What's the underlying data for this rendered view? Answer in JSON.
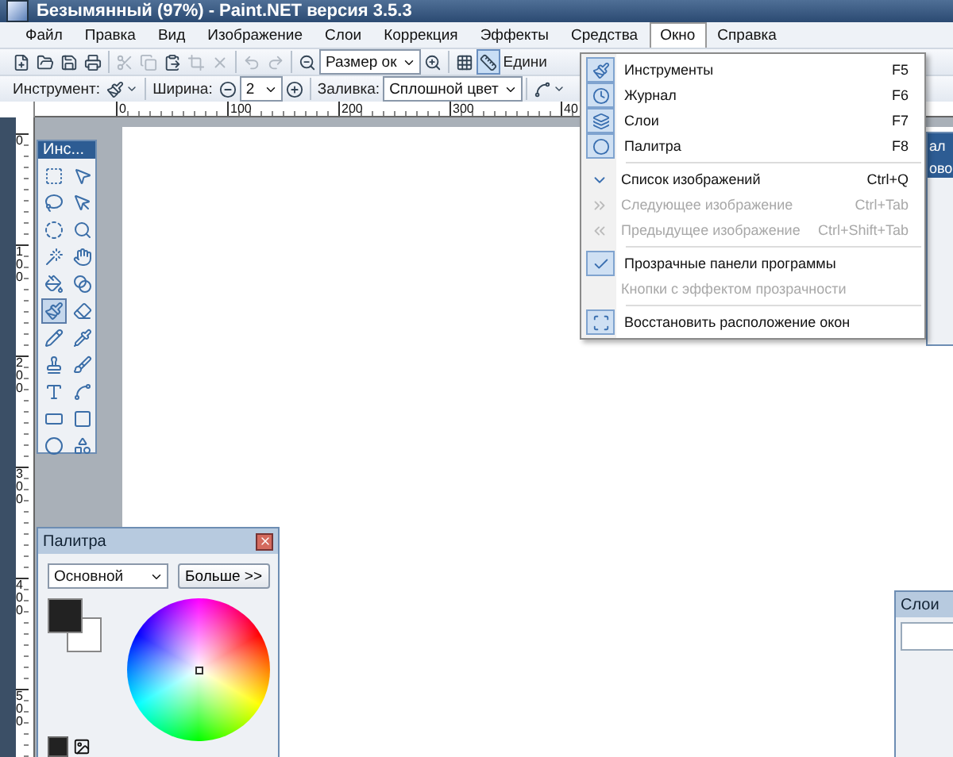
{
  "window": {
    "title": "Безымянный (97%) - Paint.NET версия 3.5.3"
  },
  "menu_bar": [
    {
      "label": "Файл",
      "selected": false
    },
    {
      "label": "Правка",
      "selected": false
    },
    {
      "label": "Вид",
      "selected": false
    },
    {
      "label": "Изображение",
      "selected": false
    },
    {
      "label": "Слои",
      "selected": false
    },
    {
      "label": "Коррекция",
      "selected": false
    },
    {
      "label": "Эффекты",
      "selected": false
    },
    {
      "label": "Средства",
      "selected": false
    },
    {
      "label": "Окно",
      "selected": true
    },
    {
      "label": "Справка",
      "selected": false
    }
  ],
  "toolbar_rows": [
    [
      {
        "kind": "button",
        "disabled": false
      },
      {
        "kind": "button",
        "disabled": false
      },
      {
        "kind": "button",
        "disabled": false
      },
      {
        "kind": "button",
        "disabled": false
      },
      {
        "kind": "separator"
      },
      {
        "kind": "button",
        "disabled": true
      },
      {
        "kind": "button",
        "disabled": true
      },
      {
        "kind": "button",
        "disabled": false
      },
      {
        "kind": "button",
        "disabled": true
      },
      {
        "kind": "button",
        "disabled": true
      },
      {
        "kind": "separator"
      },
      {
        "kind": "button",
        "disabled": true
      },
      {
        "kind": "button",
        "disabled": true
      },
      {
        "kind": "separator"
      },
      {
        "kind": "button",
        "disabled": false
      },
      {
        "kind": "select",
        "value": "Размер ок"
      },
      {
        "kind": "button",
        "disabled": false
      },
      {
        "kind": "separator"
      },
      {
        "kind": "button",
        "disabled": false,
        "on": false
      },
      {
        "kind": "button",
        "disabled": false,
        "on": true
      },
      {
        "kind": "label",
        "text": "Едини"
      }
    ],
    [
      {
        "kind": "label",
        "text": "Инструмент:"
      },
      {
        "kind": "button",
        "disabled": false
      },
      {
        "kind": "separator"
      },
      {
        "kind": "label",
        "text": "Ширина:"
      },
      {
        "kind": "button",
        "disabled": false
      },
      {
        "kind": "select",
        "value": "2"
      },
      {
        "kind": "button",
        "disabled": false
      },
      {
        "kind": "separator"
      },
      {
        "kind": "label",
        "text": "Заливка:"
      },
      {
        "kind": "select",
        "value": "Сплошной цвет"
      },
      {
        "kind": "separator"
      },
      {
        "kind": "button",
        "disabled": false
      }
    ]
  ],
  "ruler": {
    "h_labels": [
      "0",
      "100",
      "200",
      "300",
      "40"
    ],
    "v_labels": [
      "0",
      "100",
      "200",
      "300",
      "400",
      "500"
    ]
  },
  "tools_window": {
    "title": "Инс...",
    "tools": [
      {
        "selected": false
      },
      {
        "selected": false
      },
      {
        "selected": false
      },
      {
        "selected": false
      },
      {
        "selected": false
      },
      {
        "selected": false
      },
      {
        "selected": false
      },
      {
        "selected": false
      },
      {
        "selected": false
      },
      {
        "selected": false
      },
      {
        "selected": true
      },
      {
        "selected": false
      },
      {
        "selected": false
      },
      {
        "selected": false
      },
      {
        "selected": false
      },
      {
        "selected": false
      },
      {
        "selected": false
      },
      {
        "selected": false
      },
      {
        "selected": false
      },
      {
        "selected": false
      },
      {
        "selected": false
      },
      {
        "selected": false
      }
    ]
  },
  "palette_window": {
    "title": "Палитра",
    "mode": "Основной",
    "more_button": "Больше >>"
  },
  "history_window": {
    "title": "ал",
    "item": "ово"
  },
  "layers_window": {
    "title": "Слои"
  },
  "window_menu": [
    {
      "kind": "item",
      "label": "Инструменты",
      "shortcut": "F5",
      "disabled": false,
      "checked": false
    },
    {
      "kind": "item",
      "label": "Журнал",
      "shortcut": "F6",
      "disabled": false,
      "checked": false
    },
    {
      "kind": "item",
      "label": "Слои",
      "shortcut": "F7",
      "disabled": false,
      "checked": false
    },
    {
      "kind": "item",
      "label": "Палитра",
      "shortcut": "F8",
      "disabled": false,
      "checked": false
    },
    {
      "kind": "separator"
    },
    {
      "kind": "item",
      "label": "Список изображений",
      "shortcut": "Ctrl+Q",
      "disabled": false,
      "checked": false
    },
    {
      "kind": "item",
      "label": "Следующее изображение",
      "shortcut": "Ctrl+Tab",
      "disabled": true,
      "checked": false
    },
    {
      "kind": "item",
      "label": "Предыдущее изображение",
      "shortcut": "Ctrl+Shift+Tab",
      "disabled": true,
      "checked": false
    },
    {
      "kind": "separator"
    },
    {
      "kind": "item",
      "label": "Прозрачные панели программы",
      "disabled": false,
      "checked": true
    },
    {
      "kind": "item",
      "label": "Кнопки с эффектом прозрачности",
      "disabled": true,
      "checked": false
    },
    {
      "kind": "separator"
    },
    {
      "kind": "item",
      "label": "Восстановить расположение окон",
      "disabled": false,
      "checked": false
    }
  ]
}
